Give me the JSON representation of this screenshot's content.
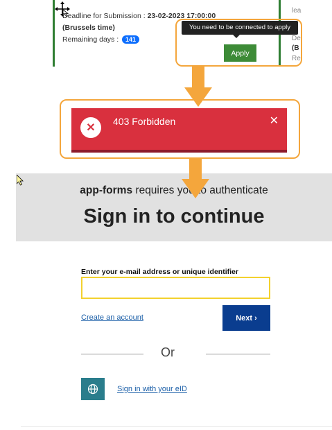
{
  "call_card": {
    "deadline_label": "Deadline for Submission :",
    "deadline_value": "23-02-2023 17:00:00",
    "timezone": "(Brussels time)",
    "remaining_label": "Remaining days :",
    "remaining_days": "141",
    "tooltip": "You need to be connected to apply",
    "apply_label": "Apply",
    "side_line1": "lea",
    "side_line2": "De",
    "side_line3": "(B",
    "side_line4": "Re"
  },
  "error": {
    "title": "403 Forbidden",
    "icon_glyph": "✕",
    "close_glyph": "✕"
  },
  "signin": {
    "app_name": "app-forms",
    "requires_text": "requires you to authenticate",
    "title": "Sign in to continue"
  },
  "form": {
    "email_label": "Enter your e-mail address or unique identifier",
    "email_value": "",
    "create_account": "Create an account",
    "next_label": "Next ›",
    "or_text": "Or",
    "eid_label": "Sign in with your eID"
  },
  "colors": {
    "highlight": "#f4a63c",
    "error_red": "#d9303e",
    "apply_green": "#3d8b37",
    "next_blue": "#0a3d8f",
    "eid_teal": "#2a7d8c",
    "input_yellow": "#f3d12e"
  },
  "icons": [
    "move-cursor-icon",
    "arrow-down-icon",
    "error-x-icon",
    "close-icon",
    "mouse-pointer-icon",
    "globe-icon"
  ]
}
